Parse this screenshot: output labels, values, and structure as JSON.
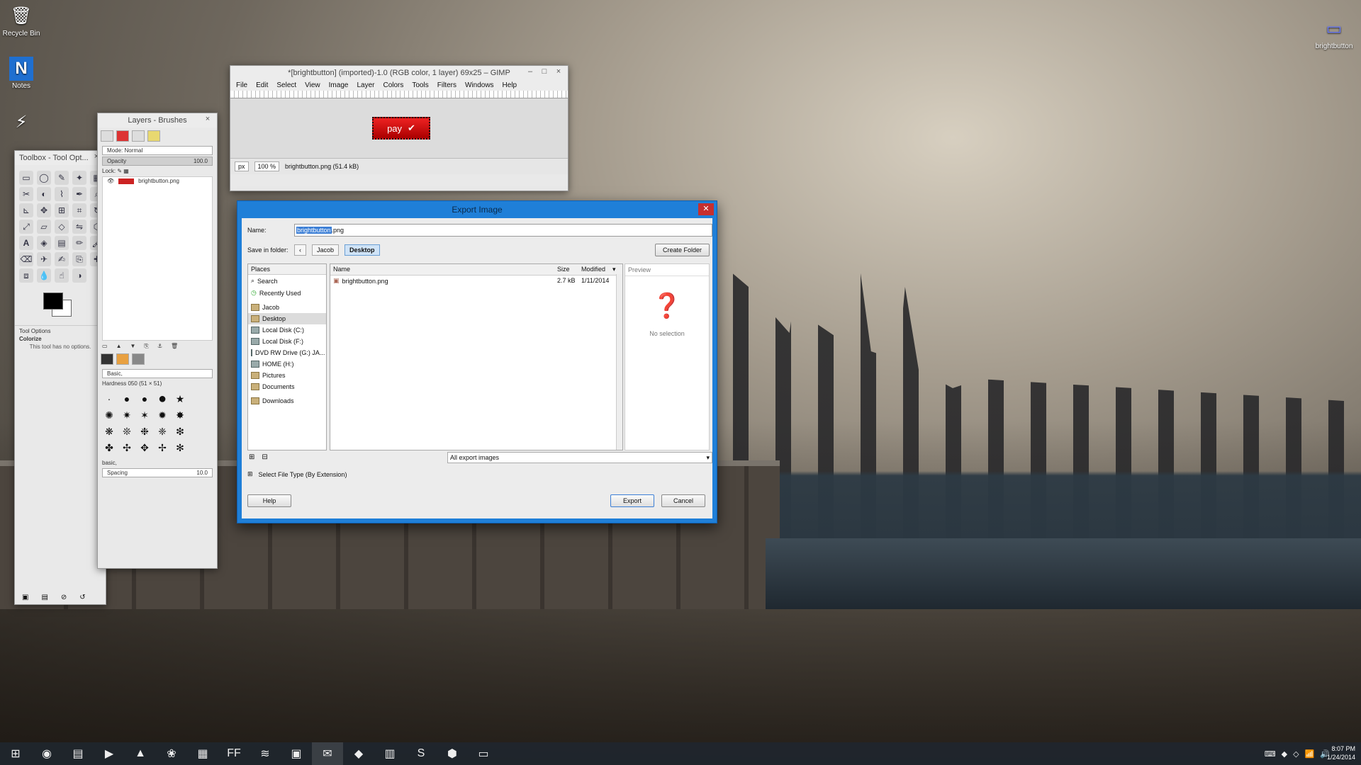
{
  "desktop": {
    "icons": [
      {
        "label": "Recycle Bin",
        "glyph": "🗑"
      },
      {
        "label": "Notes",
        "glyph": "N"
      },
      {
        "label": "",
        "glyph": "⚡"
      },
      {
        "label": "brightbutton",
        "glyph": "▭"
      }
    ]
  },
  "image_window": {
    "title": "*[brightbutton] (imported)-1.0 (RGB color, 1 layer) 69x25 – GIMP",
    "menu": [
      "File",
      "Edit",
      "Select",
      "View",
      "Image",
      "Layer",
      "Colors",
      "Tools",
      "Filters",
      "Windows",
      "Help"
    ],
    "canvas_label": "pay",
    "unit": "px",
    "zoom": "100 %",
    "status_file": "brightbutton.png (51.4 kB)"
  },
  "layers_panel": {
    "title": "Layers - Brushes",
    "mode_label": "Mode: Normal",
    "opacity_label": "Opacity",
    "opacity_value": "100.0",
    "lock_label": "Lock:",
    "layer_name": "brightbutton.png",
    "brush_filter": "Basic,",
    "brush_name": "Hardness 050 (51 × 51)",
    "spacing_label": "Spacing",
    "spacing_value": "10.0",
    "tags_label": "basic,"
  },
  "toolbox": {
    "title": "Toolbox - Tool Opt...",
    "tool_options_label": "Tool Options",
    "colorize_label": "Colorize",
    "no_options": "This tool has no options."
  },
  "export_dialog": {
    "title": "Export Image",
    "name_label": "Name:",
    "name_selected": "brightbutton",
    "name_ext": ".png",
    "save_in_label": "Save in folder:",
    "crumbs": [
      "Jacob",
      "Desktop"
    ],
    "create_folder": "Create Folder",
    "places_header": "Places",
    "places": [
      {
        "label": "Search",
        "icon": "search-icon"
      },
      {
        "label": "Recently Used",
        "icon": "clock-icon"
      },
      {
        "label": "Jacob",
        "icon": "folder-icon"
      },
      {
        "label": "Desktop",
        "icon": "folder-icon"
      },
      {
        "label": "Local Disk (C:)",
        "icon": "drive-icon"
      },
      {
        "label": "Local Disk (F:)",
        "icon": "drive-icon"
      },
      {
        "label": "DVD RW Drive (G:) JA...",
        "icon": "drive-icon"
      },
      {
        "label": "HOME (H:)",
        "icon": "drive-icon"
      },
      {
        "label": "Pictures",
        "icon": "folder-icon"
      },
      {
        "label": "Documents",
        "icon": "folder-icon"
      },
      {
        "label": "Downloads",
        "icon": "folder-icon"
      }
    ],
    "file_columns": [
      "Name",
      "Size",
      "Modified"
    ],
    "files": [
      {
        "name": "brightbutton.png",
        "size": "2.7 kB",
        "modified": "1/11/2014"
      }
    ],
    "preview_label": "Preview",
    "no_selection": "No selection",
    "filter_value": "All export images",
    "select_type_label": "Select File Type (By Extension)",
    "help": "Help",
    "export": "Export",
    "cancel": "Cancel"
  },
  "taskbar": {
    "clock_time": "8:07 PM",
    "clock_date": "1/24/2014",
    "apps": [
      "⊞",
      "◉",
      "▤",
      "▶",
      "▲",
      "❀",
      "▦",
      "FF",
      "≋",
      "▣",
      "✉",
      "◆",
      "▥",
      "S",
      "⬢",
      "▭"
    ]
  }
}
